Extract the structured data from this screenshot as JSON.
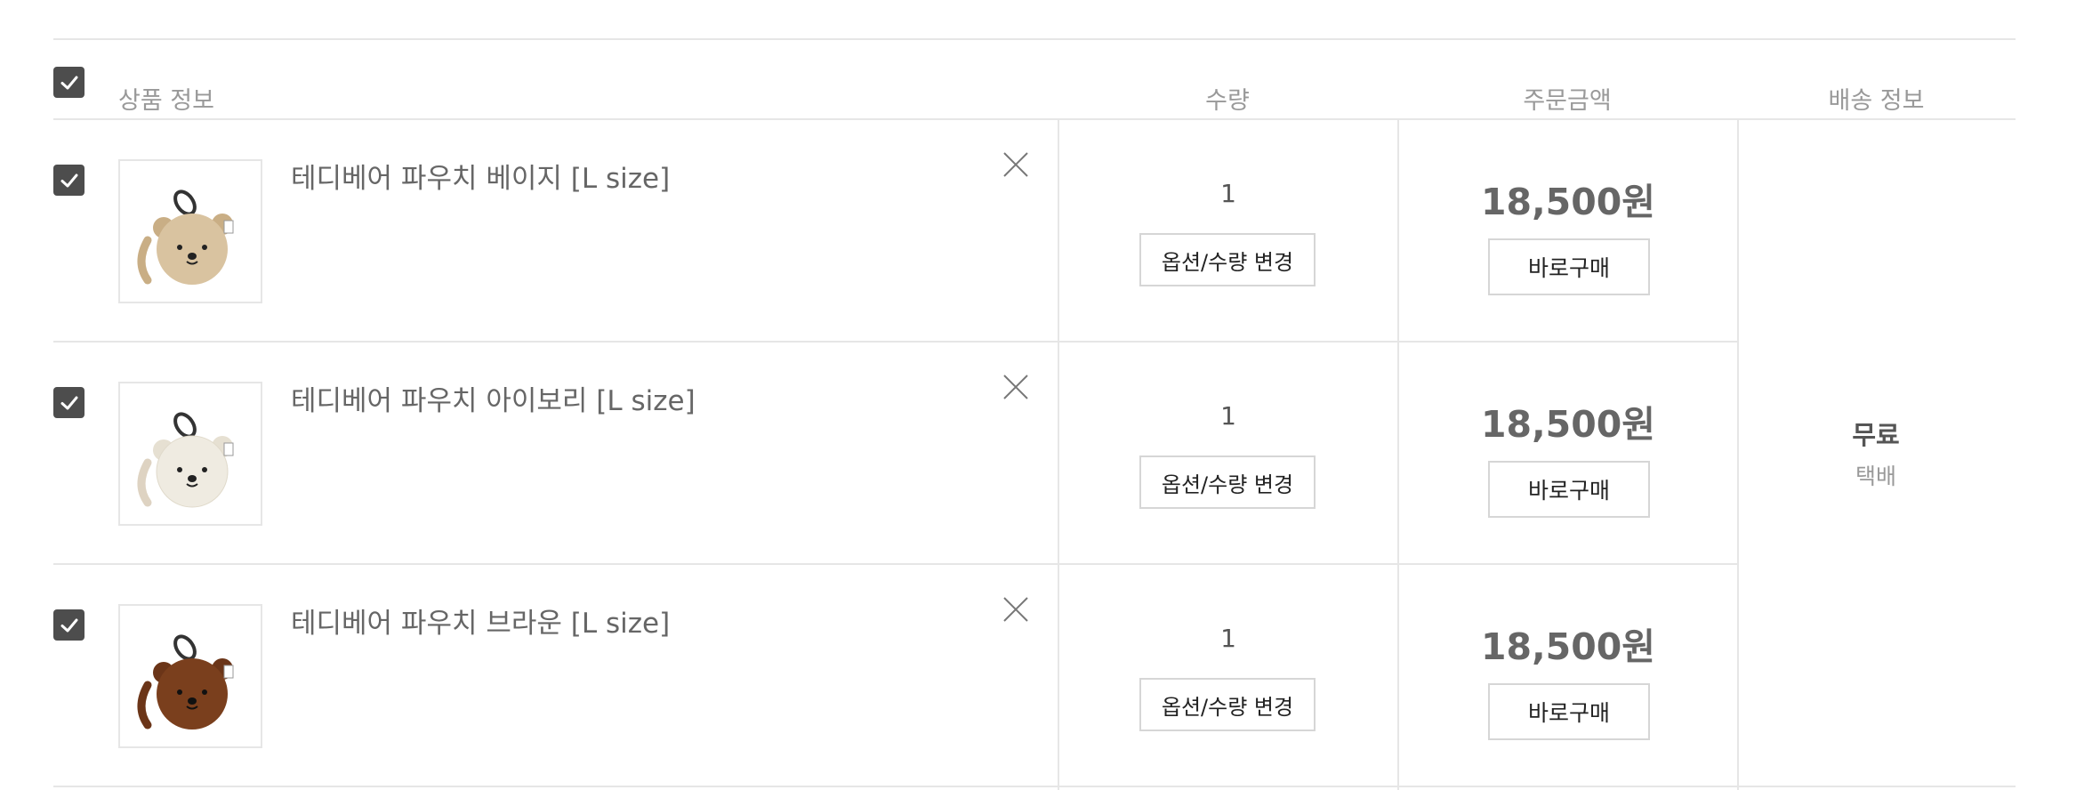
{
  "header": {
    "product_info": "상품 정보",
    "quantity": "수량",
    "order_amount": "주문금액",
    "shipping_info": "배송 정보"
  },
  "items": [
    {
      "name": "테디베어 파우치 베이지 [L size]",
      "quantity": "1",
      "option_button": "옵션/수량 변경",
      "price": "18,500원",
      "buy_button": "바로구매",
      "color": "#d9c3a0",
      "icon": "teddy-bear-pouch-beige"
    },
    {
      "name": "테디베어 파우치 아이보리 [L size]",
      "quantity": "1",
      "option_button": "옵션/수량 변경",
      "price": "18,500원",
      "buy_button": "바로구매",
      "color": "#efebe1",
      "icon": "teddy-bear-pouch-ivory"
    },
    {
      "name": "테디베어 파우치 브라운 [L size]",
      "quantity": "1",
      "option_button": "옵션/수량 변경",
      "price": "18,500원",
      "buy_button": "바로구매",
      "color": "#7a3f1d",
      "icon": "teddy-bear-pouch-brown"
    }
  ],
  "shipping": {
    "fee": "무료",
    "method": "택배"
  },
  "colors": {
    "checkbox": "#4d4d4d",
    "border": "#e6e6e6",
    "header_text": "#999999",
    "price_text": "#666666"
  }
}
